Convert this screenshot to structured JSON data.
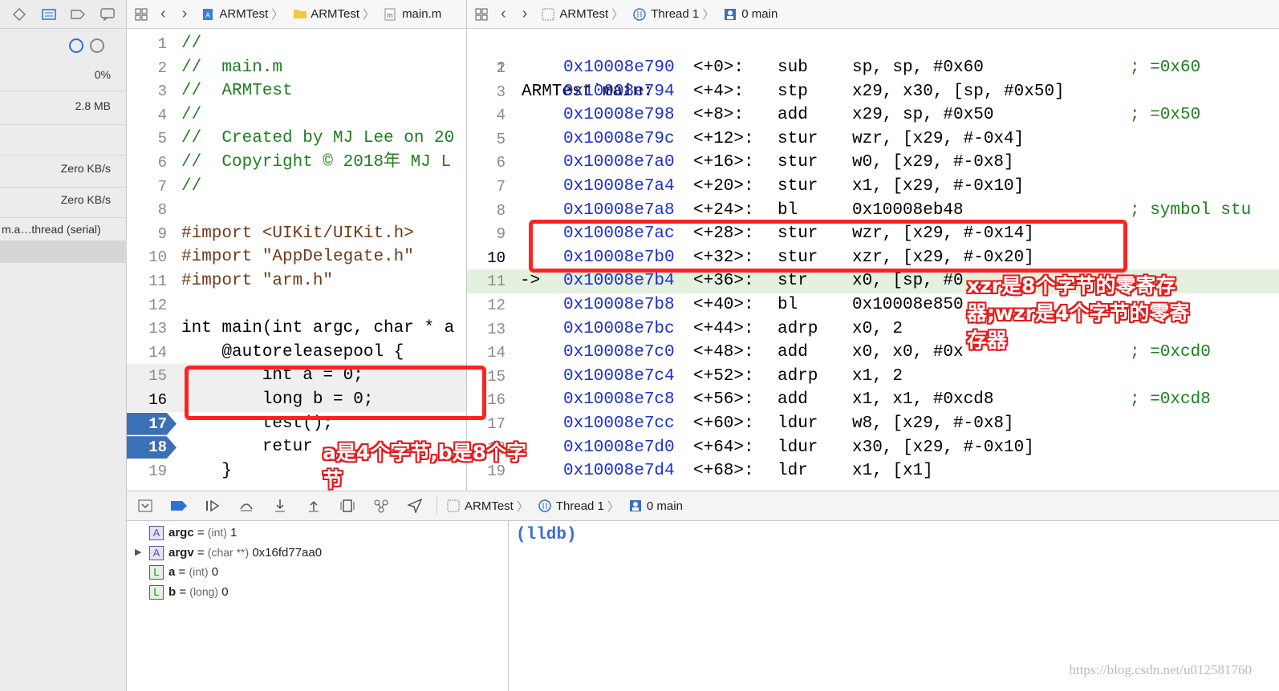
{
  "nav": {
    "cpu": "0%",
    "memory": "2.8 MB",
    "disk": "Zero KB/s",
    "network": "Zero KB/s",
    "thread_item": "m.a…thread (serial)"
  },
  "editor_jumpbar": {
    "items": [
      "ARMTest",
      "ARMTest",
      "main.m"
    ]
  },
  "asm_jumpbar": {
    "items": [
      "ARMTest",
      "Thread 1",
      "0 main"
    ]
  },
  "code": [
    {
      "n": "1",
      "t": "//"
    },
    {
      "n": "2",
      "t": "//  main.m"
    },
    {
      "n": "3",
      "t": "//  ARMTest"
    },
    {
      "n": "4",
      "t": "//"
    },
    {
      "n": "5",
      "t": "//  Created by MJ Lee on 20"
    },
    {
      "n": "6",
      "t": "//  Copyright © 2018年 MJ L"
    },
    {
      "n": "7",
      "t": "//"
    },
    {
      "n": "8",
      "t": ""
    },
    {
      "n": "9",
      "t": "#import <UIKit/UIKit.h>"
    },
    {
      "n": "10",
      "t": "#import \"AppDelegate.h\""
    },
    {
      "n": "11",
      "t": "#import \"arm.h\""
    },
    {
      "n": "12",
      "t": ""
    },
    {
      "n": "13",
      "t": "int main(int argc, char * a"
    },
    {
      "n": "14",
      "t": "    @autoreleasepool {"
    },
    {
      "n": "15",
      "t": "        int a = 0;"
    },
    {
      "n": "16",
      "t": "        long b = 0;"
    },
    {
      "n": "17",
      "t": "        test();"
    },
    {
      "n": "18",
      "t": "        retur"
    },
    {
      "n": "19",
      "t": "    }"
    }
  ],
  "asm": {
    "title": "ARMTest`main:",
    "rows": [
      {
        "n": "2",
        "addr": "0x10008e790",
        "off": "<+0>:",
        "op": "sub",
        "args": "sp, sp, #0x60",
        "cmt": "; =0x60"
      },
      {
        "n": "3",
        "addr": "0x10008e794",
        "off": "<+4>:",
        "op": "stp",
        "args": "x29, x30, [sp, #0x50]",
        "cmt": ""
      },
      {
        "n": "4",
        "addr": "0x10008e798",
        "off": "<+8>:",
        "op": "add",
        "args": "x29, sp, #0x50",
        "cmt": "; =0x50"
      },
      {
        "n": "5",
        "addr": "0x10008e79c",
        "off": "<+12>:",
        "op": "stur",
        "args": "wzr, [x29, #-0x4]",
        "cmt": ""
      },
      {
        "n": "6",
        "addr": "0x10008e7a0",
        "off": "<+16>:",
        "op": "stur",
        "args": "w0, [x29, #-0x8]",
        "cmt": ""
      },
      {
        "n": "7",
        "addr": "0x10008e7a4",
        "off": "<+20>:",
        "op": "stur",
        "args": "x1, [x29, #-0x10]",
        "cmt": ""
      },
      {
        "n": "8",
        "addr": "0x10008e7a8",
        "off": "<+24>:",
        "op": "bl",
        "args": "0x10008eb48",
        "cmt": "; symbol stu"
      },
      {
        "n": "9",
        "addr": "0x10008e7ac",
        "off": "<+28>:",
        "op": "stur",
        "args": "wzr, [x29, #-0x14]",
        "cmt": ""
      },
      {
        "n": "10",
        "addr": "0x10008e7b0",
        "off": "<+32>:",
        "op": "stur",
        "args": "xzr, [x29, #-0x20]",
        "cmt": ""
      },
      {
        "n": "11",
        "addr": "0x10008e7b4",
        "off": "<+36>:",
        "op": "str",
        "args": "x0, [sp, #0",
        "cmt": ""
      },
      {
        "n": "12",
        "addr": "0x10008e7b8",
        "off": "<+40>:",
        "op": "bl",
        "args": "0x10008e850",
        "cmt": ""
      },
      {
        "n": "13",
        "addr": "0x10008e7bc",
        "off": "<+44>:",
        "op": "adrp",
        "args": "x0, 2",
        "cmt": ""
      },
      {
        "n": "14",
        "addr": "0x10008e7c0",
        "off": "<+48>:",
        "op": "add",
        "args": "x0, x0, #0x",
        "cmt": "; =0xcd0"
      },
      {
        "n": "15",
        "addr": "0x10008e7c4",
        "off": "<+52>:",
        "op": "adrp",
        "args": "x1, 2",
        "cmt": ""
      },
      {
        "n": "16",
        "addr": "0x10008e7c8",
        "off": "<+56>:",
        "op": "add",
        "args": "x1, x1, #0xcd8",
        "cmt": "; =0xcd8"
      },
      {
        "n": "17",
        "addr": "0x10008e7cc",
        "off": "<+60>:",
        "op": "ldur",
        "args": "w8, [x29, #-0x8]",
        "cmt": ""
      },
      {
        "n": "18",
        "addr": "0x10008e7d0",
        "off": "<+64>:",
        "op": "ldur",
        "args": "x30, [x29, #-0x10]",
        "cmt": ""
      },
      {
        "n": "19",
        "addr": "0x10008e7d4",
        "off": "<+68>:",
        "op": "ldr",
        "args": "x1, [x1]",
        "cmt": ""
      }
    ],
    "pc_arrow": "->"
  },
  "debugbar": {
    "items": [
      "ARMTest",
      "Thread 1",
      "0 main"
    ]
  },
  "variables": [
    {
      "badge": "A",
      "name": "argc",
      "type": "(int)",
      "value": "1"
    },
    {
      "badge": "A",
      "name": "argv",
      "type": "(char **)",
      "value": "0x16fd77aa0"
    },
    {
      "badge": "L",
      "name": "a",
      "type": "(int)",
      "value": "0"
    },
    {
      "badge": "L",
      "name": "b",
      "type": "(long)",
      "value": "0"
    }
  ],
  "console": {
    "prompt": "(lldb)"
  },
  "annotations": {
    "note_ab": "a是4个字节,b是8个字节",
    "note_zr": "xzr是8个字节的零寄存器;wzr是4个字节的零寄存器"
  },
  "watermark": "https://blog.csdn.net/u012581760",
  "colors": {
    "annotation_red": "#f22",
    "breakpoint_blue": "#3b6fb6",
    "pc_line_green": "#e4f1df"
  }
}
